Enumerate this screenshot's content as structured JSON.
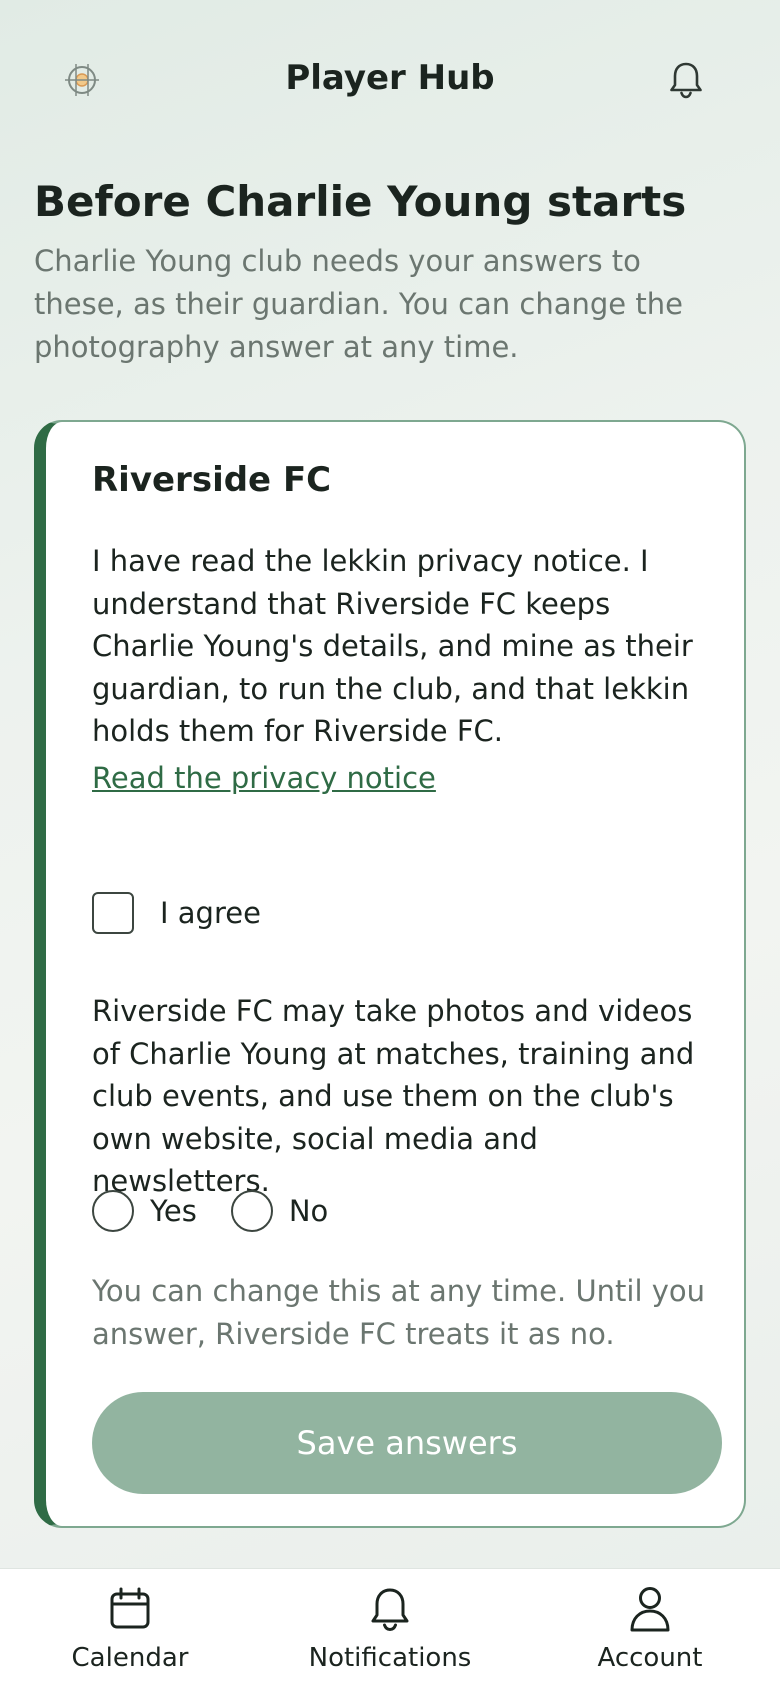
{
  "header": {
    "logo_icon": "club-crest-icon",
    "title": "Player Hub",
    "notification_icon": "bell-icon"
  },
  "page": {
    "title": "Before Charlie Young starts",
    "subtitle": "Charlie Young club needs your answers to these, as their guardian. You can change the photography answer at any time."
  },
  "card": {
    "club_name": "Riverside FC",
    "privacy_text": "I have read the lekkin privacy notice. I understand that Riverside FC keeps Charlie Young's details, and mine as their guardian, to run the club, and that lekkin holds them for Riverside FC.",
    "privacy_link": "Read the privacy notice",
    "agree_label": "I agree",
    "agree_checked": false,
    "photo_text": "Riverside FC may take photos and videos of Charlie Young at matches, training and club events, and use them on the club's own website, social media and newsletters.",
    "photo_options": [
      {
        "label": "Yes",
        "selected": false
      },
      {
        "label": "No",
        "selected": false
      }
    ],
    "note_text": "You can change this at any time. Until you answer, Riverside FC treats it as no.",
    "save_label": "Save answers"
  },
  "bottom_nav": {
    "items": [
      {
        "label": "Calendar",
        "icon": "calendar-icon"
      },
      {
        "label": "Notifications",
        "icon": "bell-icon"
      },
      {
        "label": "Account",
        "icon": "person-icon"
      }
    ]
  },
  "colors": {
    "accent": "#2f6b45",
    "button_disabled": "#92b4a0",
    "muted_text": "#6b7670"
  }
}
